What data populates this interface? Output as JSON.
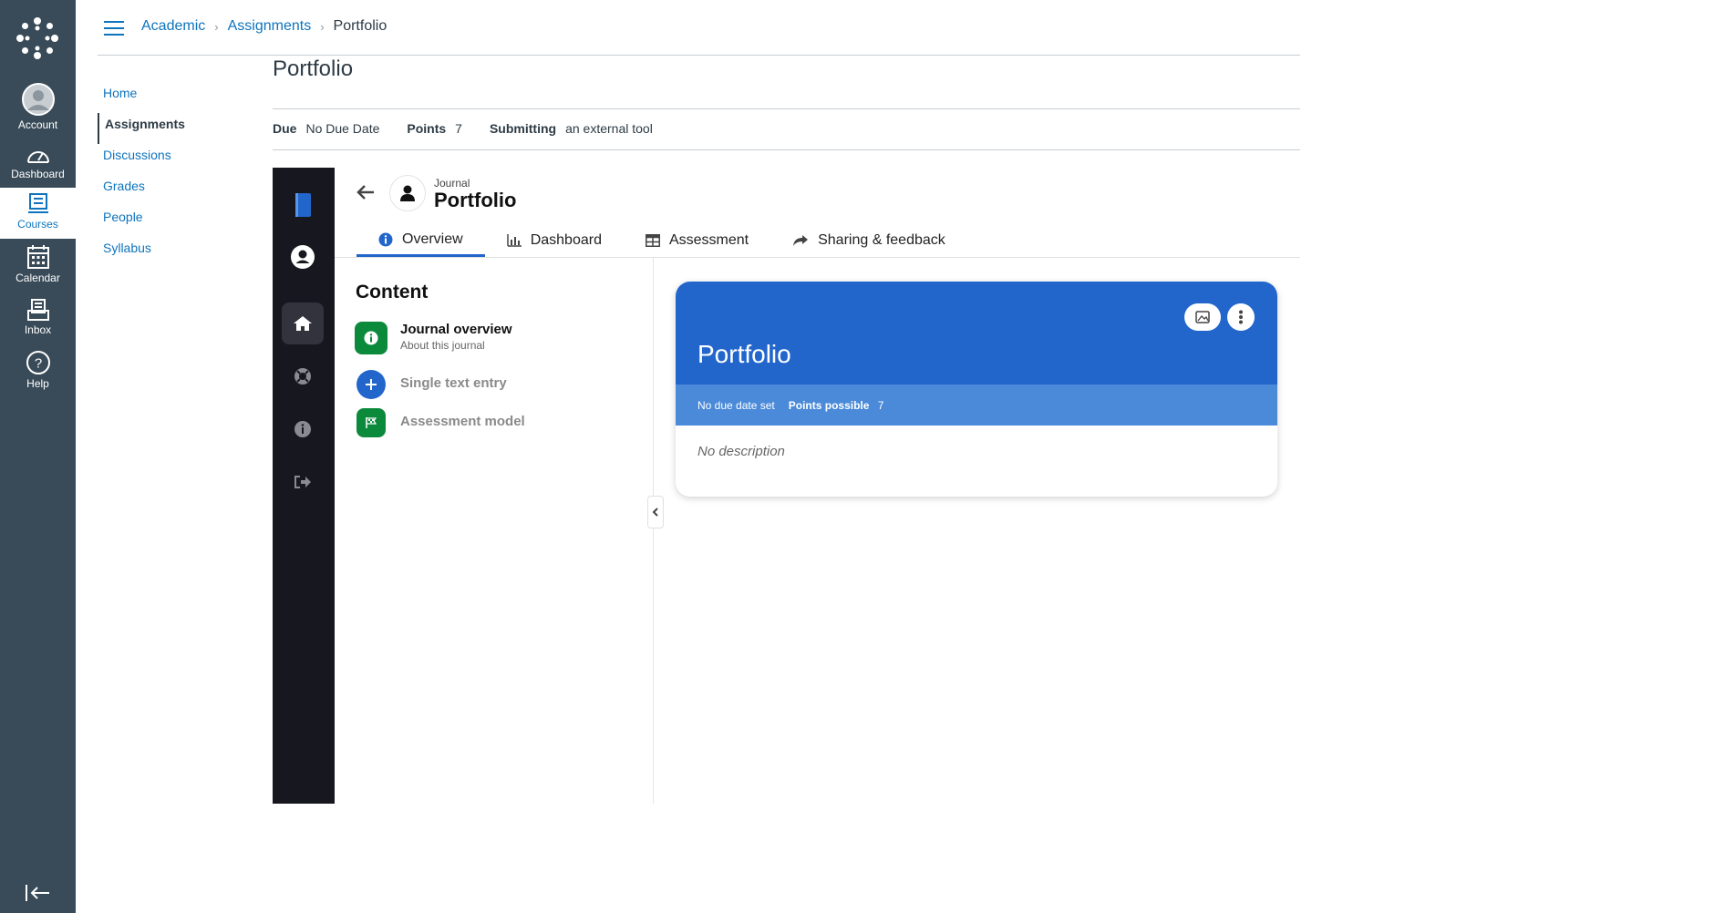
{
  "global_nav": {
    "items": [
      {
        "label": "Account",
        "icon": "account-icon"
      },
      {
        "label": "Dashboard",
        "icon": "dashboard-icon"
      },
      {
        "label": "Courses",
        "icon": "courses-icon"
      },
      {
        "label": "Calendar",
        "icon": "calendar-icon"
      },
      {
        "label": "Inbox",
        "icon": "inbox-icon"
      },
      {
        "label": "Help",
        "icon": "help-icon"
      }
    ],
    "active": "Courses"
  },
  "breadcrumb": {
    "items": [
      "Academic",
      "Assignments"
    ],
    "current": "Portfolio"
  },
  "course_nav": {
    "items": [
      "Home",
      "Assignments",
      "Discussions",
      "Grades",
      "People",
      "Syllabus"
    ],
    "active": "Assignments"
  },
  "assignment": {
    "title": "Portfolio",
    "due_label": "Due",
    "due_value": "No Due Date",
    "points_label": "Points",
    "points_value": "7",
    "submitting_label": "Submitting",
    "submitting_value": "an external tool"
  },
  "tool": {
    "journal_label": "Journal",
    "journal_title": "Portfolio",
    "tabs": [
      {
        "label": "Overview",
        "icon": "info-icon"
      },
      {
        "label": "Dashboard",
        "icon": "bar-chart-icon"
      },
      {
        "label": "Assessment",
        "icon": "table-icon"
      },
      {
        "label": "Sharing & feedback",
        "icon": "share-icon"
      }
    ],
    "active_tab": "Overview",
    "content_title": "Content",
    "content_items": [
      {
        "title": "Journal overview",
        "subtitle": "About this journal"
      },
      {
        "title": "Single text entry"
      },
      {
        "title": "Assessment model"
      }
    ],
    "card": {
      "title": "Portfolio",
      "due": "No due date set",
      "points_label": "Points possible",
      "points_value": "7",
      "description": "No description"
    }
  },
  "colors": {
    "nav_bg": "#394b58",
    "link": "#0e74bd",
    "brand_blue": "#2266cc",
    "card_sub": "#4a8ad9",
    "rail_bg": "#171720",
    "green": "#0c8a3c"
  }
}
